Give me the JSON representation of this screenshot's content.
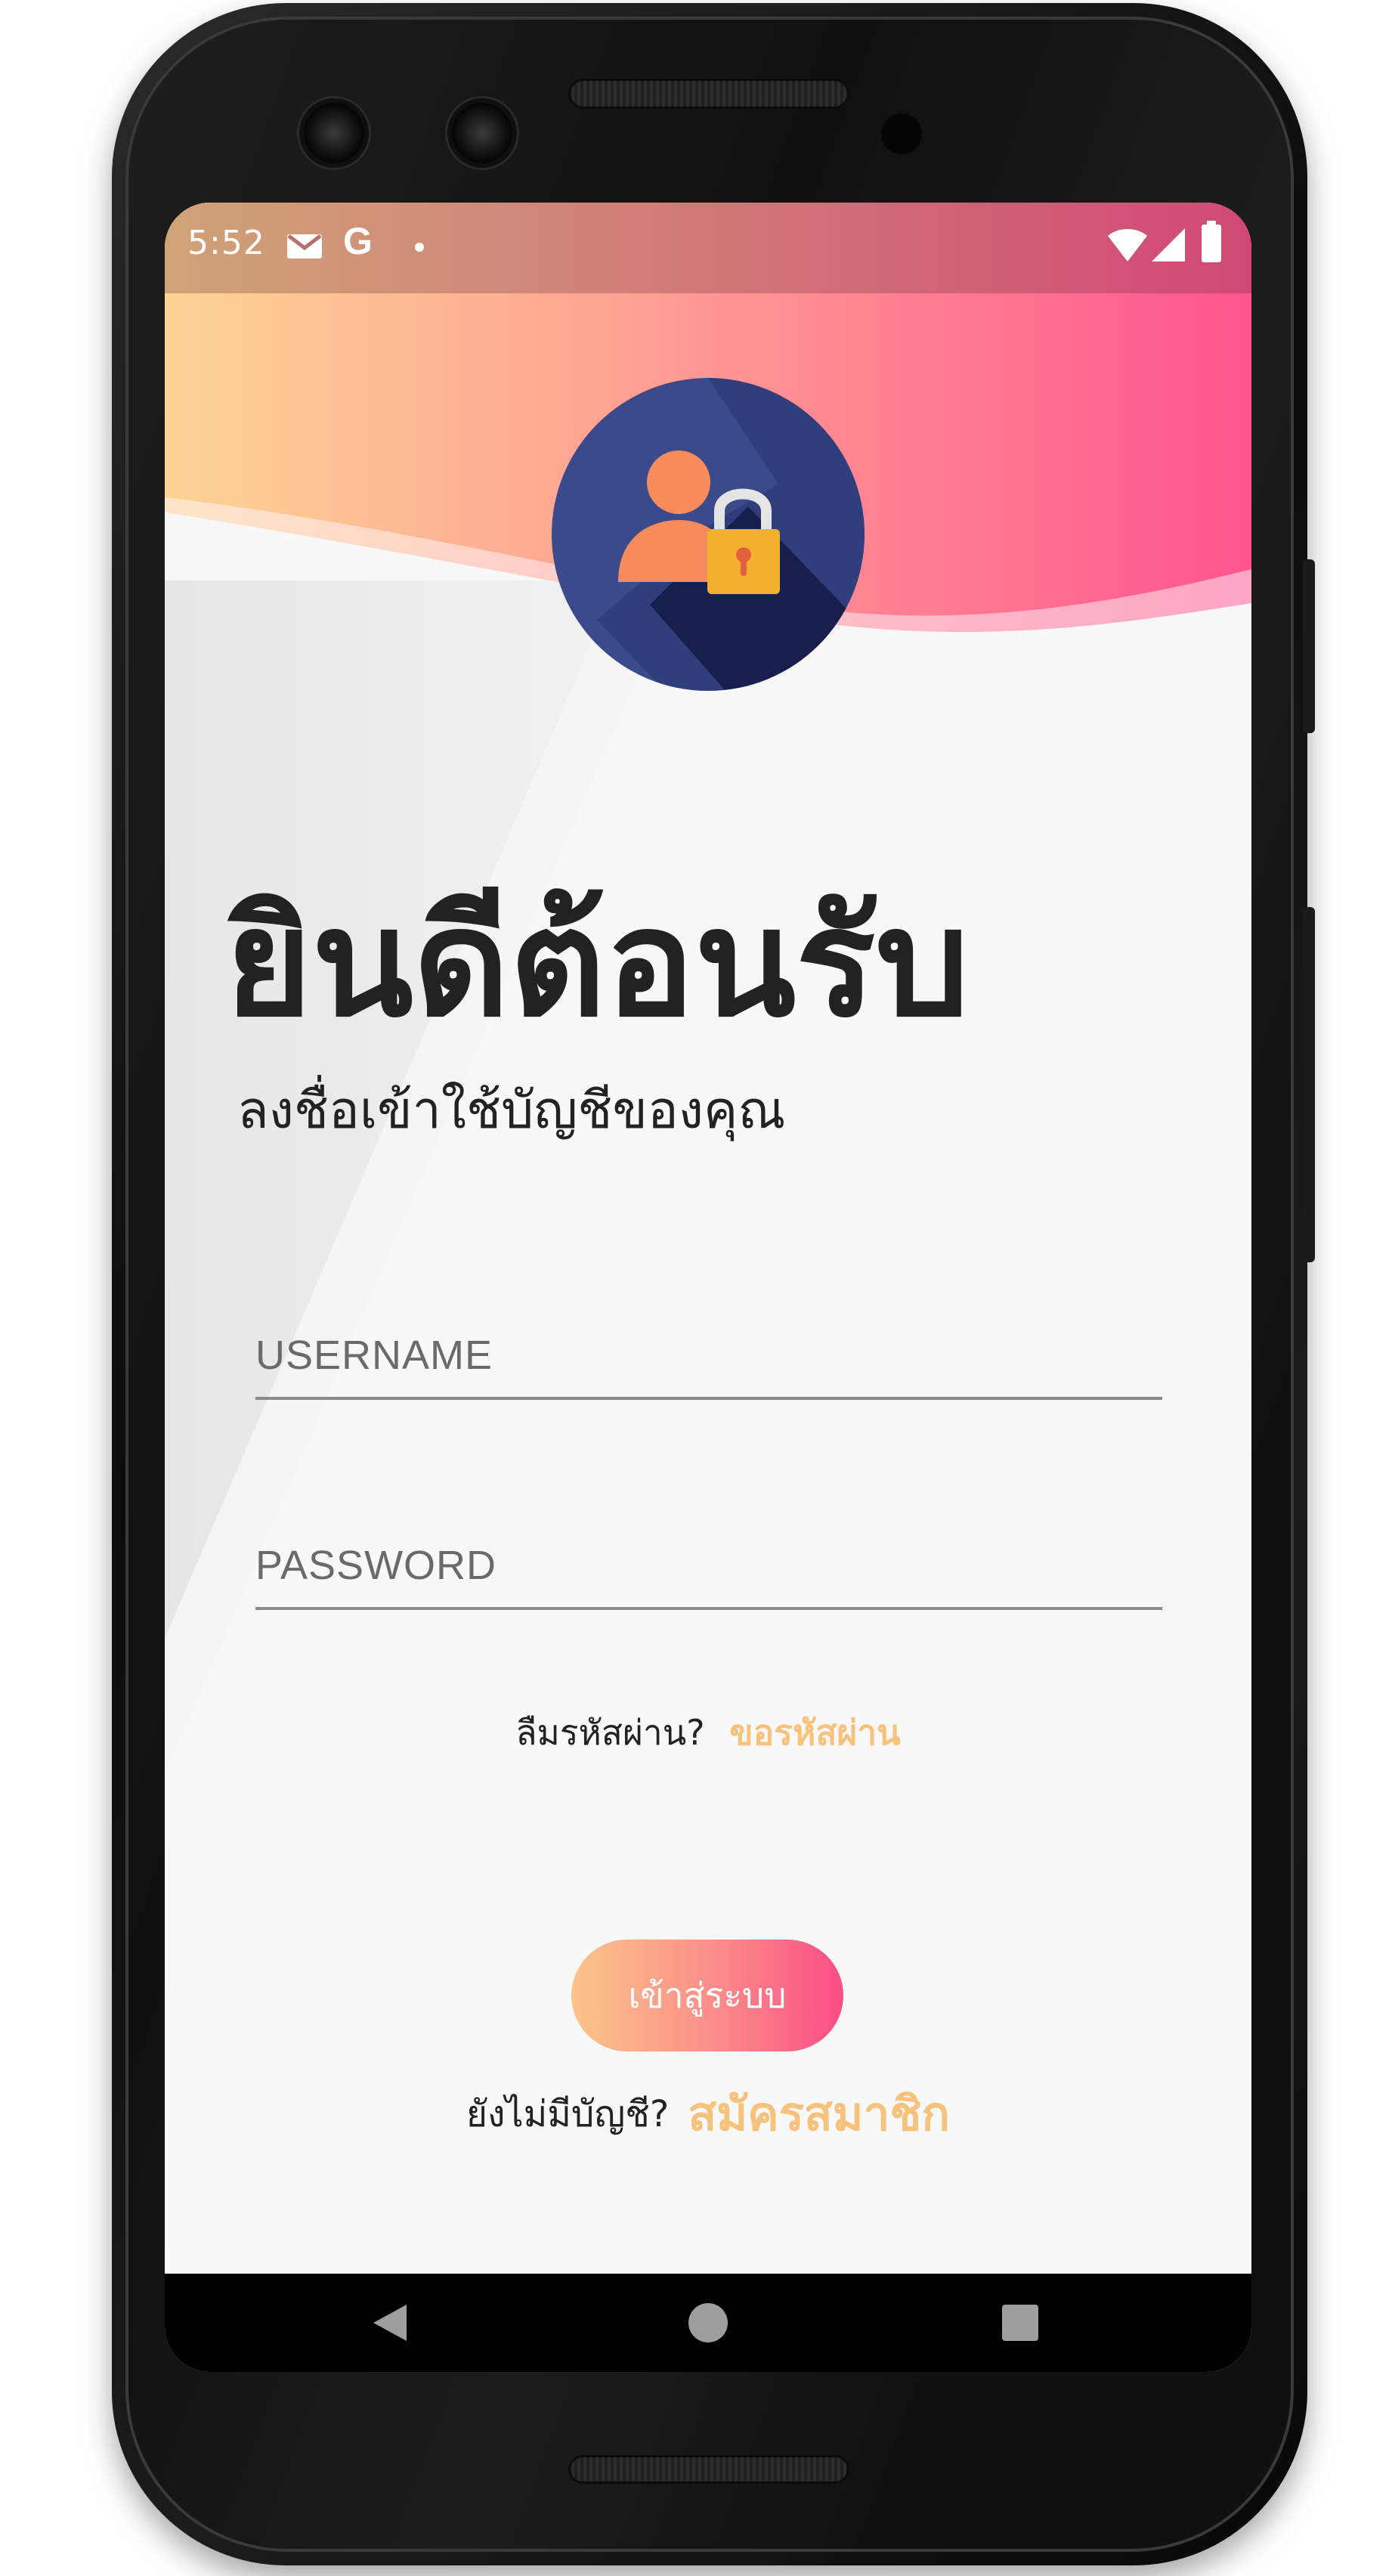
{
  "status_bar": {
    "time": "5:52",
    "icons": [
      "gmail-icon",
      "google-icon",
      "notification-dot-icon",
      "wifi-icon",
      "signal-icon",
      "battery-icon"
    ],
    "google_letter": "G"
  },
  "header": {
    "logo": "user-lock-icon",
    "colors": {
      "gradient_start": "#fdd393",
      "gradient_end": "#ff5590",
      "logo_circle": "#3a4a8a"
    }
  },
  "welcome": {
    "title": "ยินดีต้อนรับ",
    "subtitle": "ลงชื่อเข้าใช้บัญชีของคุณ"
  },
  "form": {
    "username_placeholder": "USERNAME",
    "password_placeholder": "PASSWORD",
    "forgot_text": "ลืมรหัสผ่าน?",
    "forgot_link": "ขอรหัสผ่าน",
    "login_label": "เข้าสู่ระบบ",
    "signup_text": "ยังไม่มีบัญชี?",
    "signup_link": "สมัครสมาชิก",
    "accent_color": "#f7c27c"
  },
  "nav_bar": {
    "buttons": [
      "back-icon",
      "home-icon",
      "recents-icon"
    ]
  }
}
